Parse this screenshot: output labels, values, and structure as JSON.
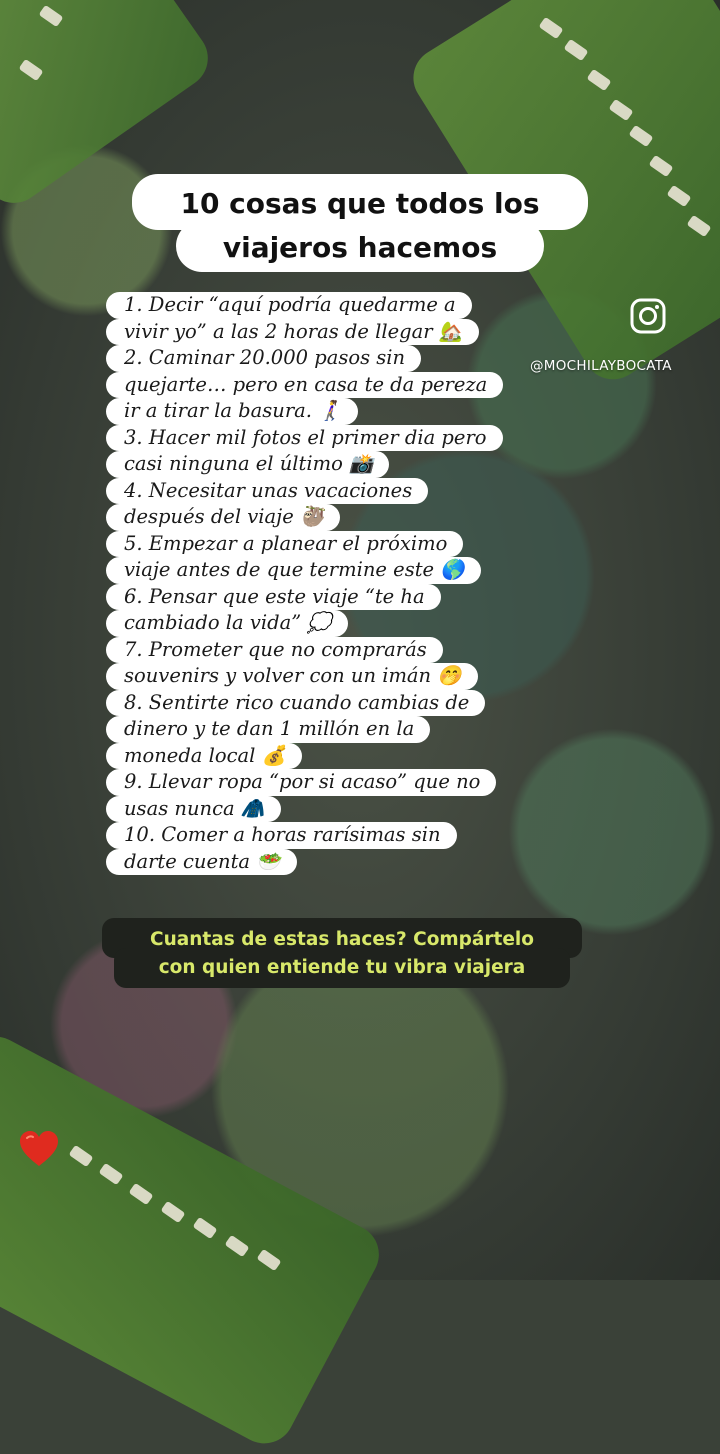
{
  "title": {
    "line1": "10 cosas que todos los",
    "line2": "viajeros hacemos"
  },
  "handle": "@MOCHILAYBOCATA",
  "list_lines": [
    "1. Decir “aquí podría quedarme a",
    "vivir yo” a las 2 horas de llegar 🏡",
    "2. Caminar 20.000 pasos sin",
    "quejarte… pero en casa te da pereza",
    "ir a tirar la basura. 🚶‍♀️",
    "3. Hacer mil fotos el primer dia pero",
    "casi ninguna el último 📸",
    "4. Necesitar unas vacaciones",
    "después del viaje 🦥",
    "5. Empezar a planear el próximo",
    "viaje antes de que termine este 🌎",
    "6. Pensar que este viaje “te ha",
    "cambiado la vida” 💭",
    "7. Prometer que no comprarás",
    "souvenirs y volver con un imán 🤭",
    "8. Sentirte rico cuando cambias de",
    "dinero y te dan 1 millón en la",
    "moneda local 💰",
    "9. Llevar ropa “por si acaso” que no",
    "usas nunca 🧥",
    "10. Comer a horas rarísimas sin",
    "darte cuenta 🥗"
  ],
  "cta": {
    "line1": "Cuantas de estas haces? Compártelo",
    "line2": "con quien entiende tu vibra viajera"
  },
  "colors": {
    "cta_text": "#d8e86a",
    "cta_bg": "#1f221d",
    "heart": "#e02b1f"
  },
  "icons": {
    "instagram": "instagram-icon",
    "heart": "heart-icon"
  }
}
